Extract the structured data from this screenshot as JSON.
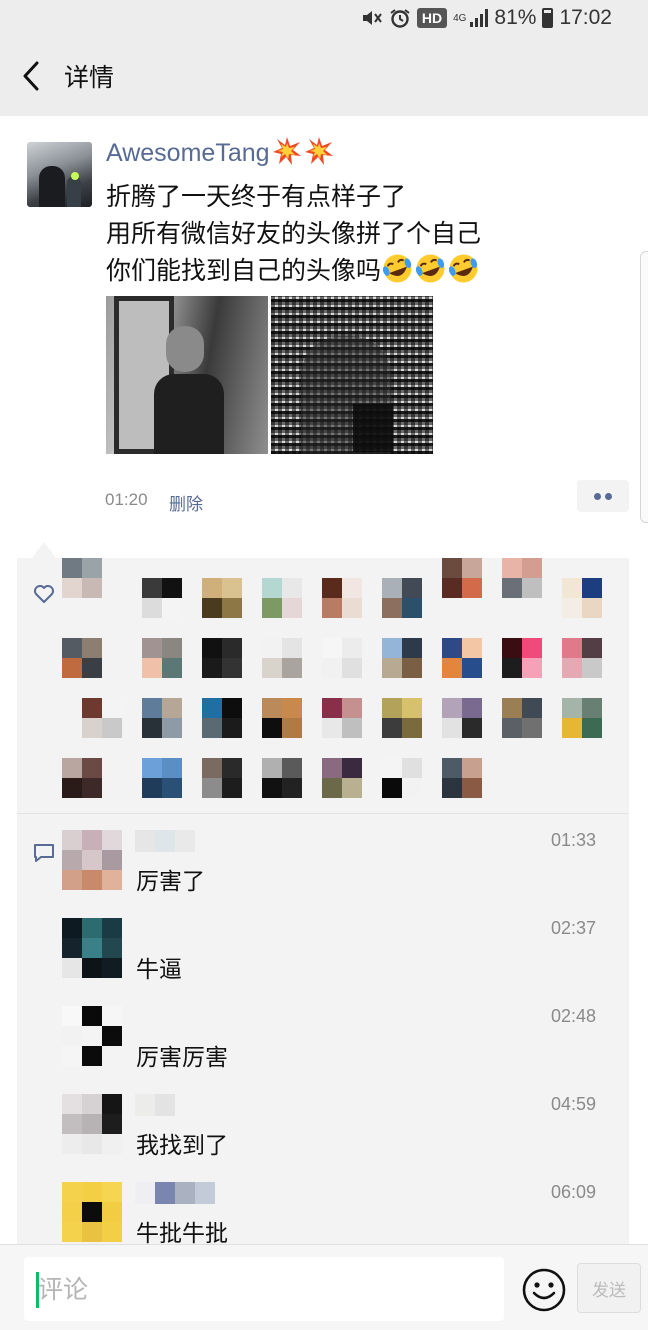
{
  "status_bar": {
    "network": "4G",
    "hd_badge": "HD",
    "battery": "81%",
    "time": "17:02",
    "icons": [
      "mute-icon",
      "alarm-icon",
      "hd-badge",
      "signal-icon",
      "battery-icon"
    ]
  },
  "header": {
    "title": "详情",
    "back_icon": "back-icon"
  },
  "post": {
    "username": "AwesomeTang",
    "username_emoji": "collision-emoji",
    "lines": [
      "折腾了一天终于有点样子了",
      "用所有微信好友的头像拼了个自己",
      "你们能找到自己的头像吗"
    ],
    "line_emoji": "rofl-emoji",
    "photos": [
      "selfie-photo",
      "mosaic-photo"
    ],
    "time": "01:20",
    "delete_label": "删除",
    "colors": {
      "link": "#576b95",
      "accent": "#07c160"
    }
  },
  "likes": {
    "icon": "heart-icon"
  },
  "comments": [
    {
      "text": "厉害了",
      "time": "01:33"
    },
    {
      "text": "牛逼",
      "time": "02:37"
    },
    {
      "text": "厉害厉害",
      "time": "02:48"
    },
    {
      "text": "我找到了",
      "time": "04:59"
    },
    {
      "text": "牛批牛批",
      "time": "06:09"
    }
  ],
  "comment_bar": {
    "placeholder": "评论",
    "emoji_icon": "smiley-icon",
    "send_label": "发送"
  }
}
